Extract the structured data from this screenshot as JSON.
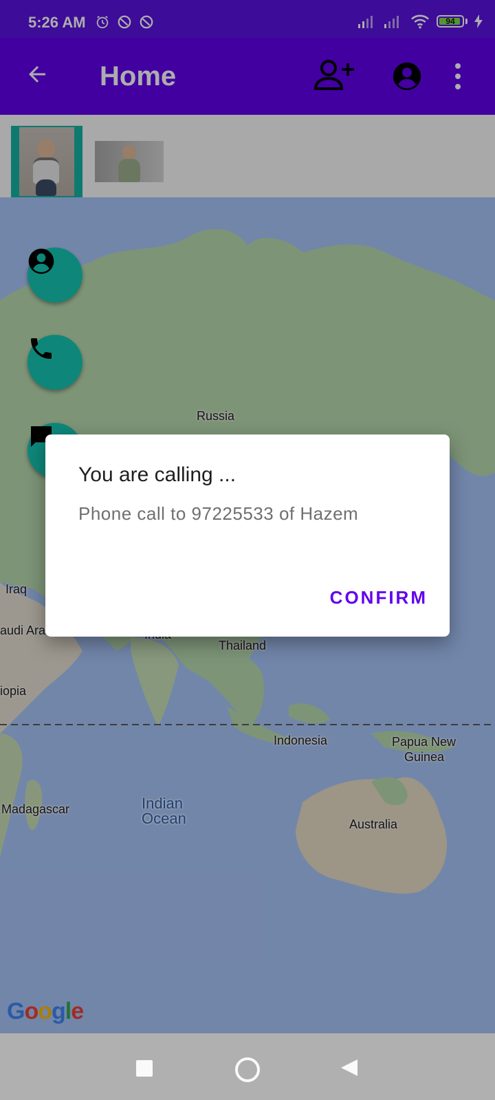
{
  "status_bar": {
    "time": "5:26 AM",
    "battery_level": "94",
    "battery_fraction": 0.94,
    "icons_left": [
      "alarm-icon",
      "do-not-disturb-icon",
      "do-not-disturb-icon"
    ],
    "icons_right": [
      "signal-icon",
      "signal-icon",
      "wifi-icon",
      "battery-icon",
      "charging-icon"
    ]
  },
  "app_bar": {
    "title": "Home",
    "icons": [
      "back-arrow-icon",
      "add-user-icon",
      "account-circle-icon",
      "more-vert-icon"
    ]
  },
  "photo_strip": {
    "selected_index": 0,
    "items": [
      "child-photo-1",
      "child-photo-2"
    ]
  },
  "map": {
    "labels": {
      "russia": "Russia",
      "iraq": "Iraq",
      "saudi_arabia": "audi Arabia",
      "india": "India",
      "thailand": "Thailand",
      "ethiopia": "iopia",
      "indonesia": "Indonesia",
      "papua_new_guinea_1": "Papua New",
      "papua_new_guinea_2": "Guinea",
      "madagascar": "Madagascar",
      "indian_ocean_1": "Indian",
      "indian_ocean_2": "Ocean",
      "australia": "Australia"
    },
    "attribution": "Google",
    "fabs": [
      "account-circle-icon",
      "phone-icon",
      "message-icon"
    ]
  },
  "dialog": {
    "title": "You are calling ...",
    "message": "Phone call to 97225533 of Hazem",
    "confirm_label": "CONFIRM"
  },
  "colors": {
    "primary": "#6200ee",
    "accent": "#16c7b4",
    "ocean": "#a9c6fb",
    "land": "#b9dab0"
  }
}
